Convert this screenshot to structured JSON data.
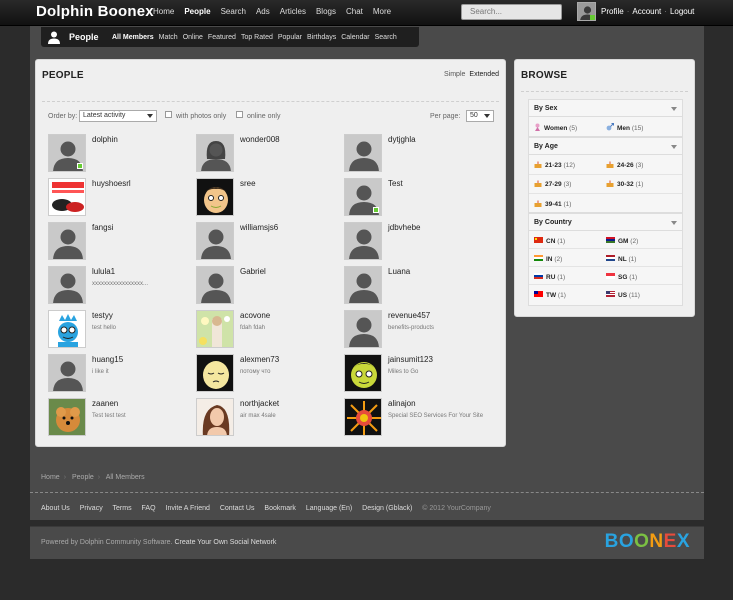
{
  "app": {
    "logo": "Dolphin Boonex"
  },
  "topnav": {
    "items": [
      "Home",
      "People",
      "Search",
      "Ads",
      "Articles",
      "Blogs",
      "Chat",
      "More"
    ],
    "active": "People"
  },
  "search": {
    "placeholder": "Search..."
  },
  "usernav": {
    "items": [
      "Profile",
      "Account",
      "Logout"
    ]
  },
  "subnav": {
    "title": "People",
    "items": [
      "All Members",
      "Match",
      "Online",
      "Featured",
      "Top Rated",
      "Popular",
      "Birthdays",
      "Calendar",
      "Search"
    ],
    "active": "All Members"
  },
  "people_panel": {
    "title": "PEOPLE",
    "views": [
      "Simple",
      "Extended"
    ],
    "active_view": "Extended",
    "order_by_label": "Order by:",
    "order_by_value": "Latest activity",
    "with_photos_label": "with photos only",
    "online_only_label": "online only",
    "per_page_label": "Per page:",
    "per_page_value": "50"
  },
  "members": [
    {
      "name": "dolphin",
      "status": "",
      "avatar": "silhouette",
      "online": true
    },
    {
      "name": "wonder008",
      "status": "",
      "avatar": "silhouette-female",
      "online": false
    },
    {
      "name": "dytjghla",
      "status": "",
      "avatar": "silhouette",
      "online": false
    },
    {
      "name": "huyshoesrl",
      "status": "",
      "avatar": "photo-shoes",
      "online": false
    },
    {
      "name": "sree",
      "status": "",
      "avatar": "cartoon-face",
      "online": false
    },
    {
      "name": "Test",
      "status": "",
      "avatar": "silhouette",
      "online": true
    },
    {
      "name": "fangsi",
      "status": "",
      "avatar": "silhouette",
      "online": false
    },
    {
      "name": "williamsjs6",
      "status": "",
      "avatar": "silhouette",
      "online": false
    },
    {
      "name": "jdbvhebe",
      "status": "",
      "avatar": "silhouette",
      "online": false
    },
    {
      "name": "lulula1",
      "status": "xxxxxxxxxxxxxxxxx...",
      "avatar": "silhouette",
      "online": false
    },
    {
      "name": "Gabriel",
      "status": "",
      "avatar": "silhouette",
      "online": false
    },
    {
      "name": "Luana",
      "status": "",
      "avatar": "silhouette",
      "online": false
    },
    {
      "name": "testyy",
      "status": "test hello",
      "avatar": "king-cartoon",
      "online": false
    },
    {
      "name": "acovone",
      "status": "fdah fdah",
      "avatar": "photo-flowers",
      "online": false
    },
    {
      "name": "revenue457",
      "status": "benefits-products",
      "avatar": "silhouette",
      "online": false
    },
    {
      "name": "huang15",
      "status": "i like it",
      "avatar": "silhouette",
      "online": false
    },
    {
      "name": "alexmen73",
      "status": "потому что",
      "avatar": "cartoon-sleepy",
      "online": false
    },
    {
      "name": "jainsumit123",
      "status": "Miles to Go",
      "avatar": "cartoon-green",
      "online": false
    },
    {
      "name": "zaanen",
      "status": "Test test test",
      "avatar": "photo-dog",
      "online": false
    },
    {
      "name": "northjacket",
      "status": "air max 4sale",
      "avatar": "photo-woman",
      "online": false
    },
    {
      "name": "alinajon",
      "status": "Special SEO Services For Your Site",
      "avatar": "photo-sun",
      "online": false
    }
  ],
  "browse": {
    "title": "BROWSE",
    "by_sex": {
      "title": "By Sex",
      "items": [
        {
          "label": "Women",
          "count": "(5)"
        },
        {
          "label": "Men",
          "count": "(15)"
        }
      ]
    },
    "by_age": {
      "title": "By Age",
      "items": [
        {
          "label": "21-23",
          "count": "(12)"
        },
        {
          "label": "24-26",
          "count": "(3)"
        },
        {
          "label": "27-29",
          "count": "(3)"
        },
        {
          "label": "30-32",
          "count": "(1)"
        },
        {
          "label": "39-41",
          "count": "(1)"
        }
      ]
    },
    "by_country": {
      "title": "By Country",
      "items": [
        {
          "label": "CN",
          "count": "(1)",
          "flag": "cn"
        },
        {
          "label": "GM",
          "count": "(2)",
          "flag": "gm"
        },
        {
          "label": "IN",
          "count": "(2)",
          "flag": "in"
        },
        {
          "label": "NL",
          "count": "(1)",
          "flag": "nl"
        },
        {
          "label": "RU",
          "count": "(1)",
          "flag": "ru"
        },
        {
          "label": "SG",
          "count": "(1)",
          "flag": "sg"
        },
        {
          "label": "TW",
          "count": "(1)",
          "flag": "tw"
        },
        {
          "label": "US",
          "count": "(11)",
          "flag": "us"
        }
      ]
    }
  },
  "breadcrumb": [
    "Home",
    "People",
    "All Members"
  ],
  "breadcrumb_sep": "›",
  "footer_links": [
    "About Us",
    "Privacy",
    "Terms",
    "FAQ",
    "Invite A Friend",
    "Contact Us",
    "Bookmark",
    "Language (En)",
    "Design (Gblack)"
  ],
  "copyright": "© 2012 YourCompany",
  "powered": {
    "text": "Powered by Dolphin Community Software.",
    "link": "Create Your Own Social Network"
  },
  "brand": {
    "name": "BOONEX",
    "colors": [
      "#29a3e0",
      "#29a3e0",
      "#7bc043",
      "#f39c12",
      "#e74c3c",
      "#29a3e0"
    ]
  },
  "colors": {
    "online": "#66cc33",
    "panel": "#efefef",
    "topbar": "#111111"
  }
}
